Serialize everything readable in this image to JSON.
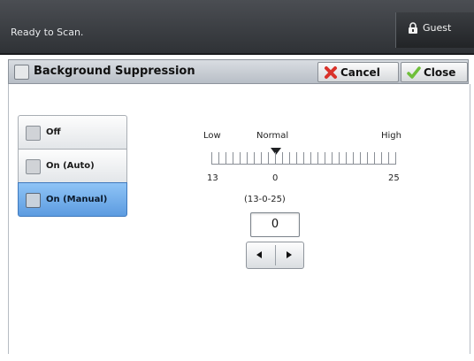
{
  "status_bar": {
    "message": "Ready to Scan.",
    "user_label": "Guest"
  },
  "feature": {
    "title": "Background Suppression",
    "cancel_label": "Cancel",
    "close_label": "Close"
  },
  "options": [
    {
      "label": "Off",
      "selected": false
    },
    {
      "label": "On (Auto)",
      "selected": false
    },
    {
      "label": "On (Manual)",
      "selected": true
    }
  ],
  "level": {
    "low_label": "Low",
    "normal_label": "Normal",
    "high_label": "High",
    "min_value": "13",
    "mid_value": "0",
    "max_value": "25",
    "range_text": "(13-0-25)",
    "current_value": "0"
  },
  "colors": {
    "selected_option": "#5c9be0",
    "status_bar": "#2f3236",
    "cancel_icon": "#d9322a",
    "close_icon": "#6fbf3a"
  }
}
